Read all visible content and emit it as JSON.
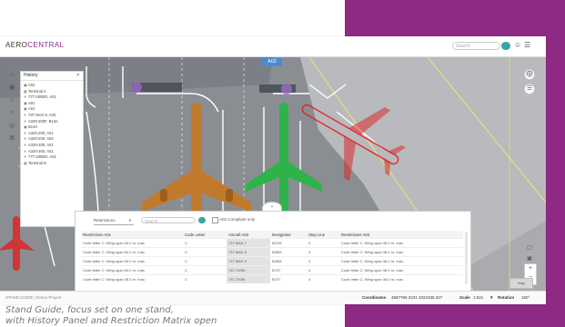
{
  "app": {
    "brand_prefix": "AERO",
    "brand_suffix": "CENTRAL",
    "accent_color": "#8e2a83",
    "teal_color": "#39a5a2"
  },
  "header": {
    "search_placeholder": "Search",
    "user_icon": "user-icon",
    "menu_icon": "hamburger-icon"
  },
  "map": {
    "stand_label": "A02",
    "selected_color": "#2db34a",
    "restricted_color": "#e02020",
    "aircraft_color": "#c17a2c"
  },
  "history": {
    "title": "History",
    "close_icon": "x-icon",
    "items": [
      {
        "icon": "stand-icon",
        "label": "A02"
      },
      {
        "icon": "terminal-icon",
        "label": "Terminal A"
      },
      {
        "icon": "plane-icon",
        "label": "777-200ER, A01"
      },
      {
        "icon": "stand-icon",
        "label": "A01"
      },
      {
        "icon": "stand-icon",
        "label": "A01"
      },
      {
        "icon": "plane-icon",
        "label": "737 MAX 8, A03"
      },
      {
        "icon": "plane-icon",
        "label": "A330-200F, B13A"
      },
      {
        "icon": "stand-icon",
        "label": "B13A"
      },
      {
        "icon": "plane-icon",
        "label": "A320-200, A01"
      },
      {
        "icon": "plane-icon",
        "label": "A320-200, A02"
      },
      {
        "icon": "plane-icon",
        "label": "A330-200, A01"
      },
      {
        "icon": "plane-icon",
        "label": "A340-300, A01"
      },
      {
        "icon": "plane-icon",
        "label": "777-200ER, A01"
      },
      {
        "icon": "terminal-icon",
        "label": "Terminal D"
      }
    ]
  },
  "left_tools": [
    "home-icon",
    "layers-icon",
    "star-icon",
    "filter-icon",
    "target-icon",
    "network-icon"
  ],
  "restrictions": {
    "filter_label": "Restrictions",
    "search_placeholder": "Search",
    "compliant_label": "A02 Compliant only",
    "columns": [
      "Restrictions A01",
      "Code Letter",
      "Aircraft A02",
      "Designator",
      "Step Line",
      "Restrictions A03"
    ],
    "rows": [
      [
        "Code letter C: Wing span 54.0 m. max.",
        "C",
        "737 MAX 7",
        "B37M",
        "4",
        "Code letter C: Wing span 36.0 m. max."
      ],
      [
        "Code letter C: Wing span 54.0 m. max.",
        "C",
        "737 MAX 8",
        "B38M",
        "4",
        "Code letter C: Wing span 36.0 m. max."
      ],
      [
        "Code letter C: Wing span 54.0 m. max.",
        "C",
        "737 MAX 9",
        "B39M",
        "4",
        "Code letter C: Wing span 36.0 m. max."
      ],
      [
        "Code letter C: Wing span 54.0 m. max.",
        "C",
        "737-700W",
        "B737",
        "4",
        "Code letter C: Wing span 36.0 m. max."
      ],
      [
        "Code letter C: Wing span 36.0 m. max.",
        "C",
        "737-700W",
        "B737",
        "4",
        "Code letter C: Wing span 36.0 m. max."
      ]
    ]
  },
  "right_tools": [
    "compass-icon",
    "list-icon"
  ],
  "right_low_tools": [
    "map-icon",
    "layers-icon",
    "fullscreen-icon"
  ],
  "map_controls": {
    "zoom_in": "+",
    "zoom_out": "−",
    "minimap_label": "Map"
  },
  "status": {
    "footer_text": "STAND GUIDE | Demo Project",
    "coordinates_label": "Coordinates",
    "coordinates_value": "4567765.2231  3322335.227",
    "scale_label": "Scale",
    "scale_value": "1:521",
    "rotation_label": "Rotation",
    "rotation_value": "180°"
  },
  "caption": {
    "line1": "Stand Guide, focus set on one stand,",
    "line2": "with History Panel and Restriction Matrix open"
  }
}
